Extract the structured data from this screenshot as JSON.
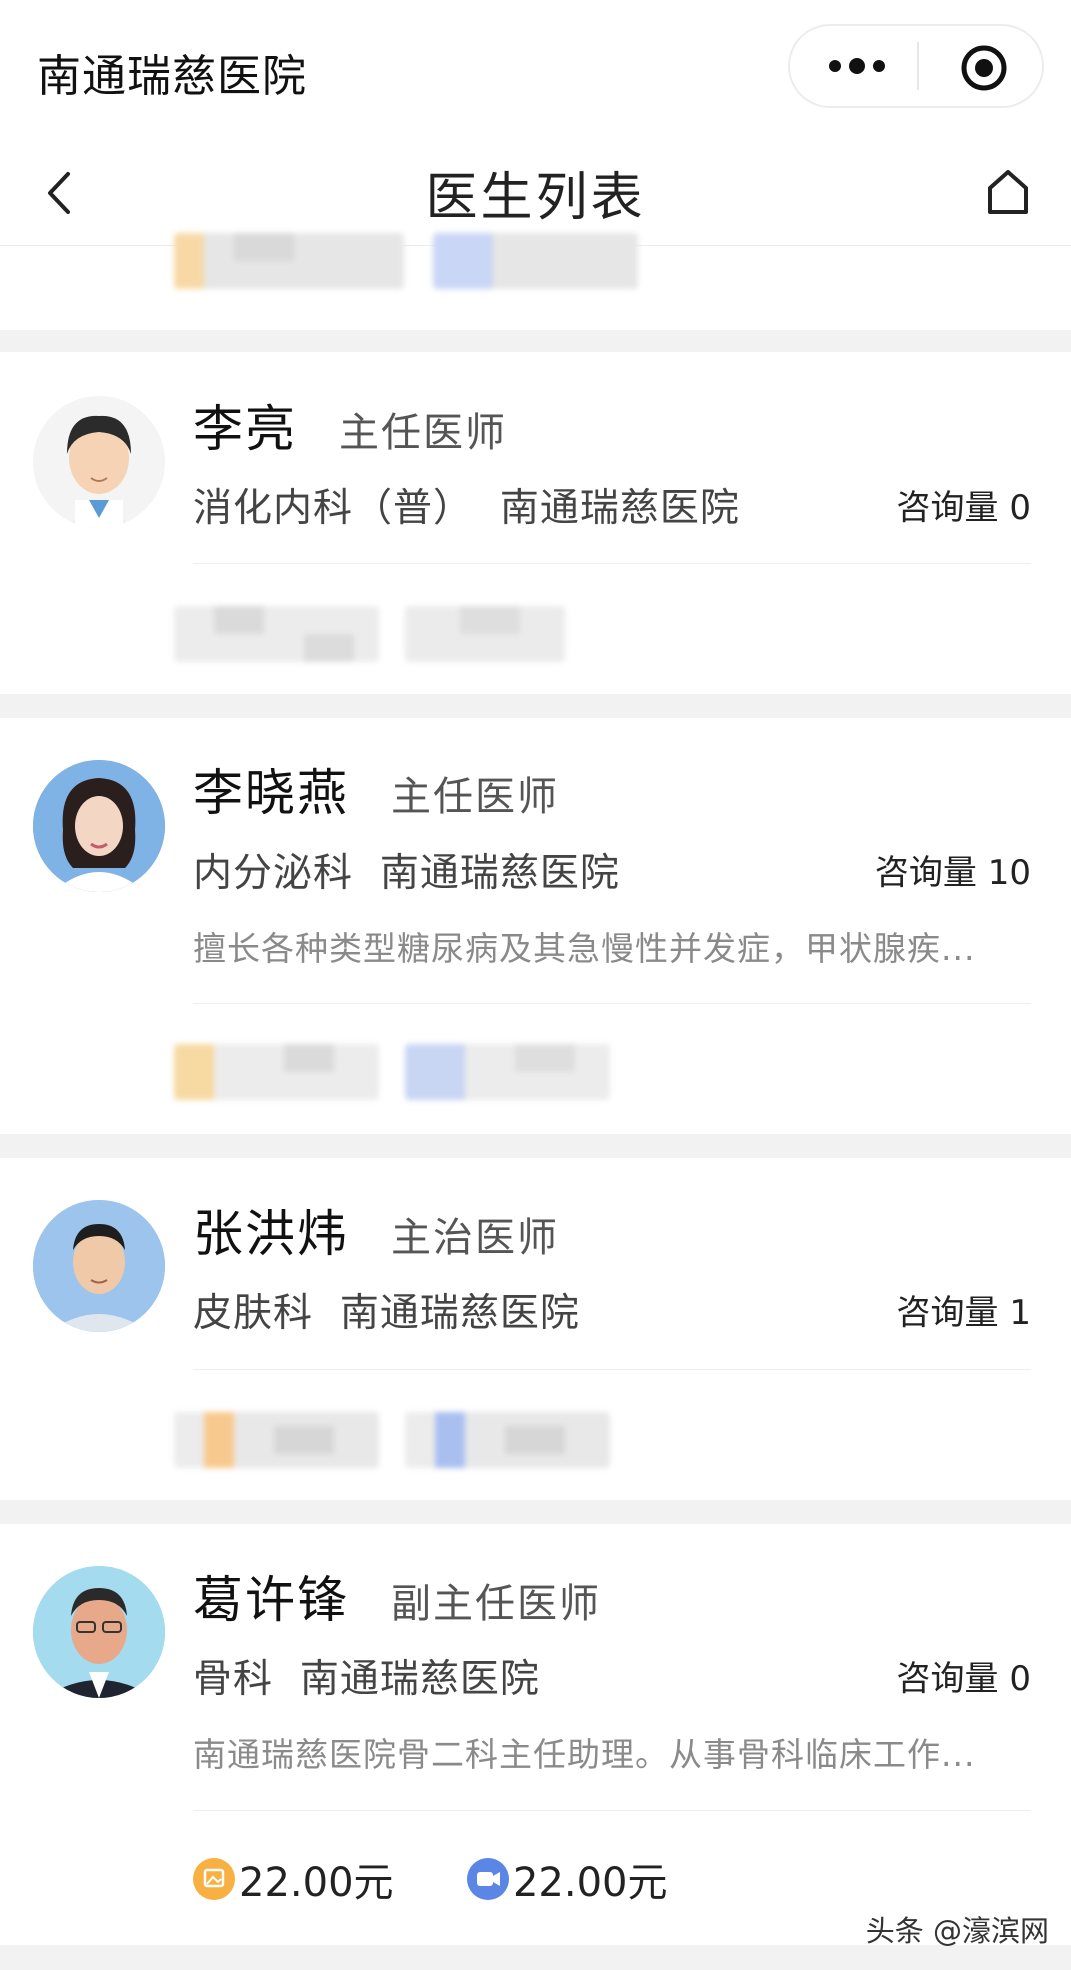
{
  "miniapp": {
    "title": "南通瑞慈医院",
    "more_icon": "more-dots-icon",
    "close_icon": "target-circle-icon"
  },
  "navbar": {
    "title": "医生列表",
    "back_icon": "chevron-left-icon",
    "home_icon": "home-icon"
  },
  "colors": {
    "accent_orange": "#f7b041",
    "accent_blue": "#5b86e5",
    "background": "#f2f2f2"
  },
  "doctors": [
    {
      "name": "李亮",
      "title": "主任医师",
      "department": "消化内科（普）",
      "hospital": "南通瑞慈医院",
      "consult_label": "咨询量",
      "consult_count": "0",
      "intro": ""
    },
    {
      "name": "李晓燕",
      "title": "主任医师",
      "department": "内分泌科",
      "hospital": "南通瑞慈医院",
      "consult_label": "咨询量",
      "consult_count": "10",
      "intro": "擅长各种类型糖尿病及其急慢性并发症，甲状腺疾..."
    },
    {
      "name": "张洪炜",
      "title": "主治医师",
      "department": "皮肤科",
      "hospital": "南通瑞慈医院",
      "consult_label": "咨询量",
      "consult_count": "1",
      "intro": ""
    },
    {
      "name": "葛许锋",
      "title": "副主任医师",
      "department": "骨科",
      "hospital": "南通瑞慈医院",
      "consult_label": "咨询量",
      "consult_count": "0",
      "intro": "南通瑞慈医院骨二科主任助理。从事骨科临床工作...",
      "prices": {
        "text_price": "22.00元",
        "video_price": "22.00元",
        "text_icon": "image-text-consult-icon",
        "video_icon": "video-consult-icon"
      }
    }
  ],
  "watermark": "头条 @濠滨网"
}
